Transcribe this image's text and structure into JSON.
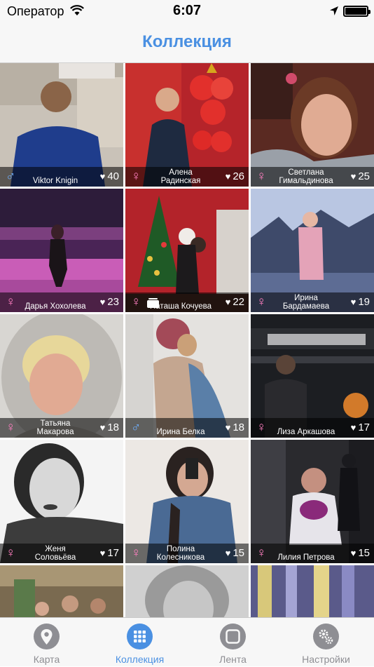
{
  "status_bar": {
    "carrier": "Оператор",
    "time": "6:07"
  },
  "nav": {
    "title": "Коллекция"
  },
  "tiles": [
    {
      "name": "Viktor Knigin",
      "gender": "male",
      "likes": "40"
    },
    {
      "name": "Алена Радинская",
      "gender": "female",
      "likes": "26"
    },
    {
      "name": "Светлана Гимальдинова",
      "gender": "female",
      "likes": "25"
    },
    {
      "name": "Дарья Хохолева",
      "gender": "female",
      "likes": "23"
    },
    {
      "name": "Наташа Кочуева",
      "gender": "female",
      "likes": "22",
      "badge": true
    },
    {
      "name": "Ирина Бардамаева",
      "gender": "female",
      "likes": "19"
    },
    {
      "name": "Татьяна Макарова",
      "gender": "female",
      "likes": "18"
    },
    {
      "name": "Ирина Белка",
      "gender": "male",
      "likes": "18"
    },
    {
      "name": "Лиза Аркашова",
      "gender": "female",
      "likes": "17"
    },
    {
      "name": "Женя Соловьёва",
      "gender": "female",
      "likes": "17"
    },
    {
      "name": "Полина Колесникова",
      "gender": "female",
      "likes": "15"
    },
    {
      "name": "Лилия Петрова",
      "gender": "female",
      "likes": "15"
    }
  ],
  "tabs": [
    {
      "label": "Карта",
      "icon": "map-pin-icon",
      "active": false
    },
    {
      "label": "Коллекция",
      "icon": "grid-icon",
      "active": true
    },
    {
      "label": "Лента",
      "icon": "square-icon",
      "active": false
    },
    {
      "label": "Настройки",
      "icon": "gear-icon",
      "active": false
    }
  ]
}
